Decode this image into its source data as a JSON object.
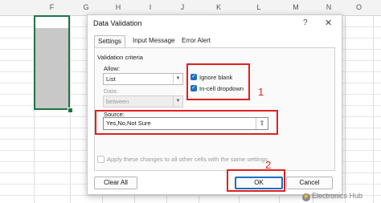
{
  "spreadsheet": {
    "columns": [
      "F",
      "G",
      "H",
      "I",
      "J",
      "K",
      "L",
      "M",
      "N",
      "O"
    ],
    "accent": "#217346"
  },
  "dialog": {
    "title": "Data Validation",
    "help_icon": "question-icon",
    "close_icon": "close-icon",
    "tabs": [
      {
        "label": "Settings",
        "active": true
      },
      {
        "label": "Input Message",
        "active": false
      },
      {
        "label": "Error Alert",
        "active": false
      }
    ],
    "criteria_heading": "Validation criteria",
    "allow_label": "Allow:",
    "allow_value": "List",
    "data_label": "Data:",
    "data_value": "between",
    "ignore_blank": {
      "label": "Ignore blank",
      "checked": true
    },
    "incell_dropdown": {
      "label": "In-cell dropdown",
      "checked": true
    },
    "source_label": "Source:",
    "source_value": "Yes,No,Not Sure",
    "apply_all": {
      "label": "Apply these changes to all other cells with the same settings",
      "checked": false
    },
    "clear_all_label": "Clear All",
    "ok_label": "OK",
    "cancel_label": "Cancel"
  },
  "annotations": {
    "marker_1": "1",
    "marker_2": "2",
    "highlight_color": "#e02020"
  },
  "watermark": {
    "text": "Electronics Hub"
  }
}
